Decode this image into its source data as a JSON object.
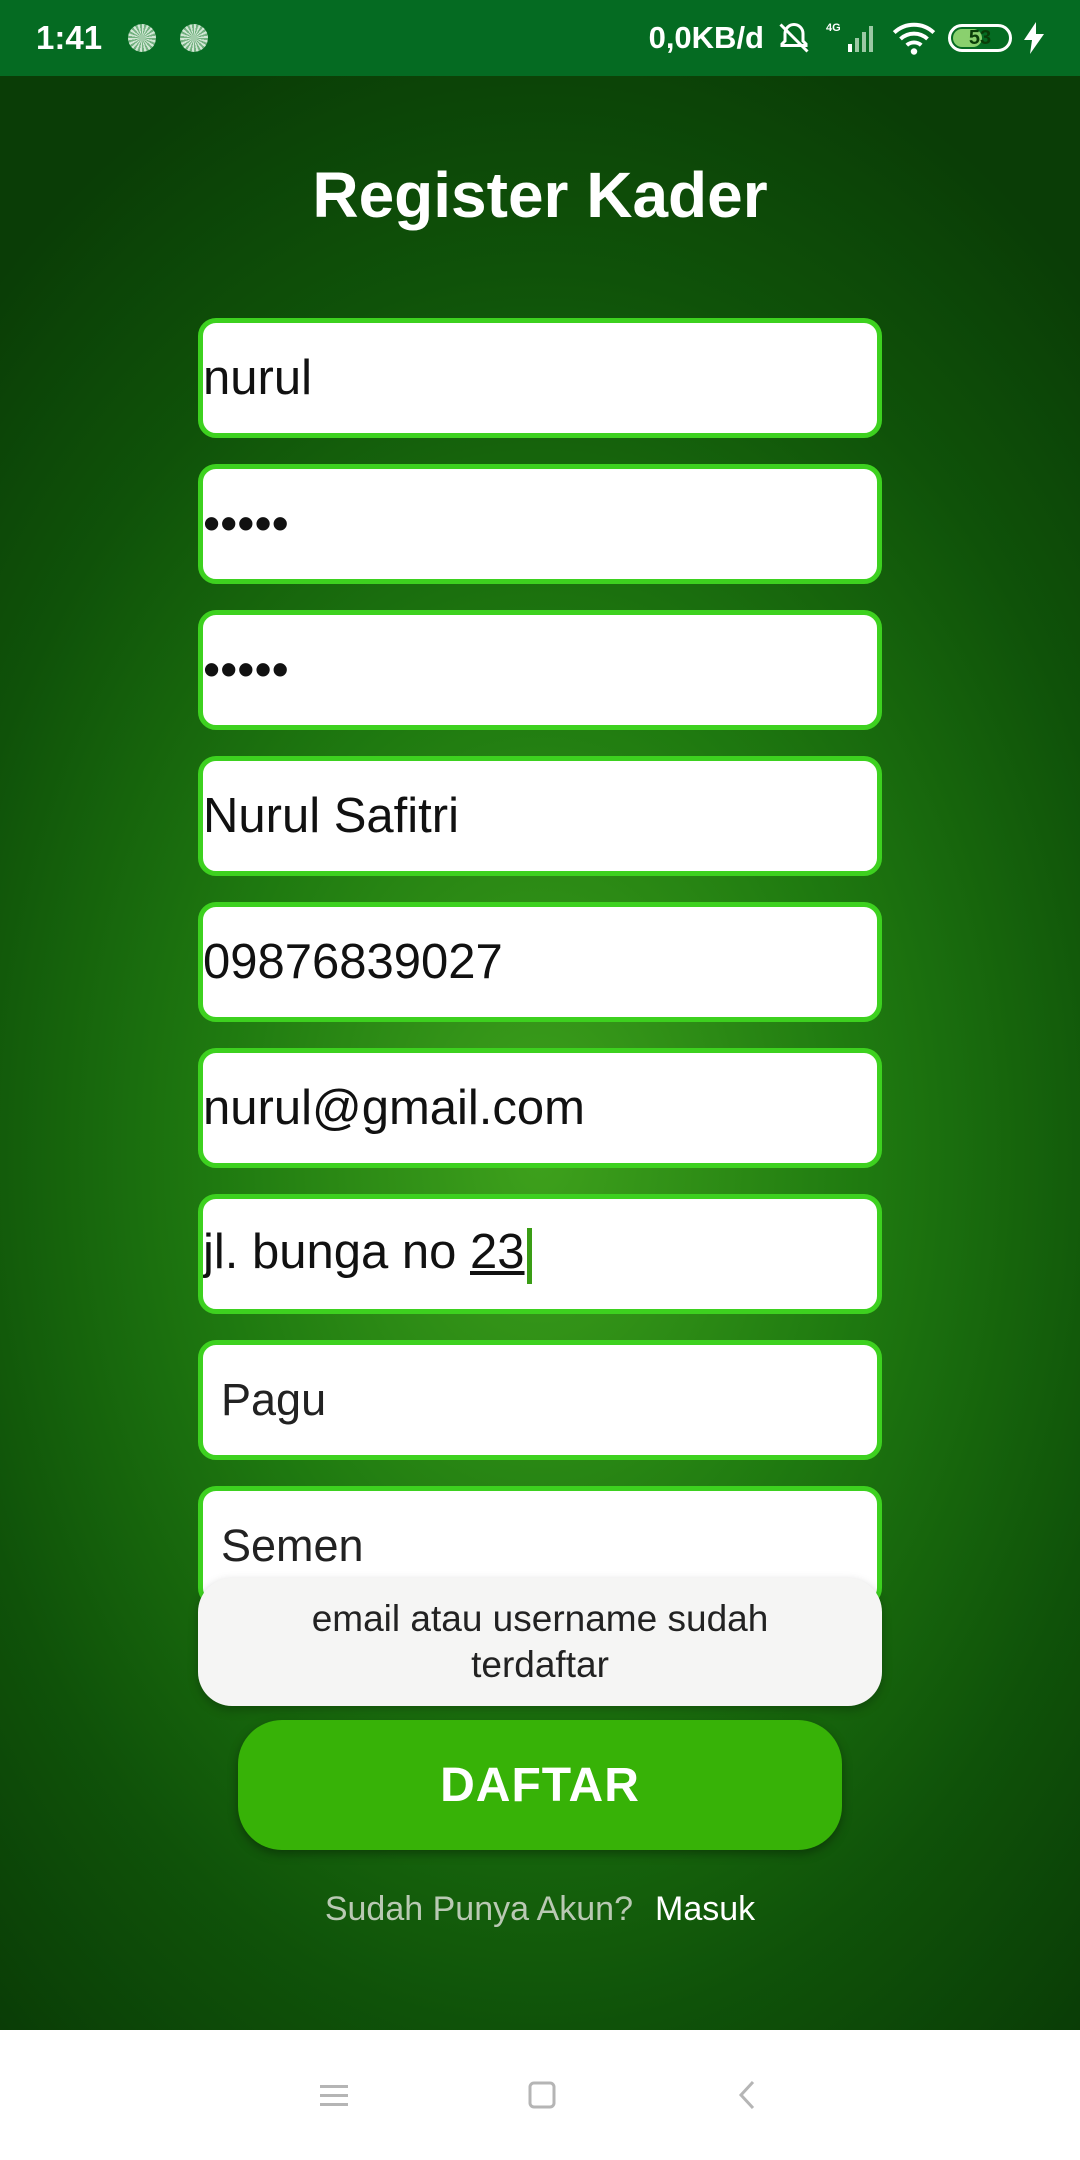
{
  "status_bar": {
    "time": "1:41",
    "network_speed": "0,0KB/d",
    "network_type": "4G",
    "battery_level": "53",
    "icons": [
      "loading-icon",
      "loading-icon",
      "bell-off-icon",
      "signal-icon",
      "wifi-icon",
      "battery-icon",
      "charging-icon"
    ]
  },
  "title": "Register Kader",
  "form": {
    "username": "nurul",
    "password": "•••••",
    "confirm_password": "•••••",
    "full_name": "Nurul Safitri",
    "phone": "09876839027",
    "email": "nurul@gmail.com",
    "address_prefix": "jl. bunga no ",
    "address_suffix": "23",
    "village_placeholder": "Pagu",
    "district_placeholder": "Semen"
  },
  "toast": "email atau username sudah terdaftar",
  "register_button": "DAFTAR",
  "footer": {
    "question": "Sudah Punya Akun?",
    "login_link": "Masuk"
  },
  "colors": {
    "accent": "#37b207",
    "field_border": "#3dd11f",
    "status_bar": "#056b22"
  },
  "nav_icons": [
    "menu-icon",
    "home-icon",
    "back-icon"
  ]
}
